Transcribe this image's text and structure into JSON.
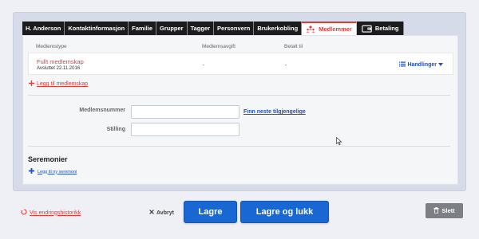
{
  "tabs": [
    {
      "label": "H. Anderson",
      "active": false
    },
    {
      "label": "Kontaktinformasjon",
      "active": false
    },
    {
      "label": "Familie",
      "active": false
    },
    {
      "label": "Grupper",
      "active": false
    },
    {
      "label": "Tagger",
      "active": false
    },
    {
      "label": "Personvern",
      "active": false
    },
    {
      "label": "Brukerkobling",
      "active": false
    },
    {
      "label": "Medlemmer",
      "active": true,
      "icon": "people-icon"
    },
    {
      "label": "Betaling",
      "active": false,
      "icon": "wallet-icon"
    }
  ],
  "table": {
    "headers": {
      "type": "Medlemstype",
      "fee": "Medlemsavgift",
      "paid_until": "Betalt til"
    },
    "row": {
      "type": "Fullt medlemskap",
      "sub": "Avsluttet 22.11.2016",
      "fee": "-",
      "paid_until": "-",
      "actions_label": "Handlinger"
    }
  },
  "add_membership_label": "Legg til medlemskap",
  "form": {
    "member_number_label": "Medlemsnummer",
    "member_number_value": "",
    "find_next_label": "Finn neste tilgjengelige",
    "position_label": "Stilling",
    "position_value": ""
  },
  "ceremonies": {
    "title": "Seremonier",
    "add_label": "Legg til ny seremoni"
  },
  "footer": {
    "history_label": "Vis endringshistorikk",
    "cancel_label": "Avbryt",
    "save_label": "Lagre",
    "save_close_label": "Lagre og lukk",
    "delete_label": "Slett"
  },
  "colors": {
    "accent": "#e53935",
    "primary": "#1967d2",
    "link": "#1f4fbf",
    "tab_bg": "#1c1c1c"
  }
}
